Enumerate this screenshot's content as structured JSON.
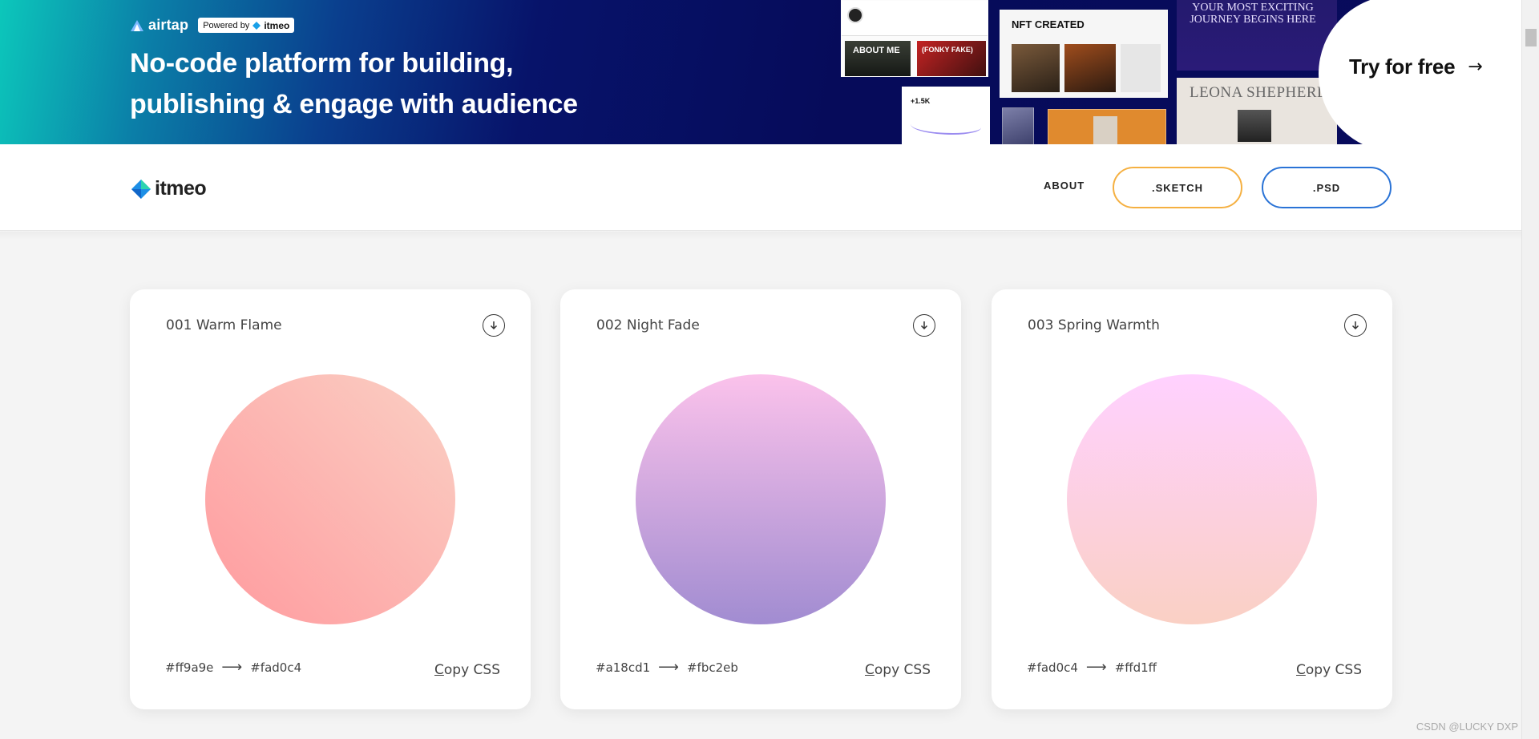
{
  "banner": {
    "brand": "airtap",
    "powered_by": "Powered by",
    "powered_brand": "itmeo",
    "headline_line1": "No-code platform for building,",
    "headline_line2": "publishing & engage with audience",
    "mock_about": "ABOUT ME",
    "mock_fake": "(FONKY FAKE)",
    "mock_nft": "NFT CREATED",
    "mock_stat": "+1.5K",
    "mock_journey": "YOUR MOST EXCITING JOURNEY BEGINS HERE",
    "mock_leona": "LEONA SHEPHERD",
    "cta": "Try for free",
    "cta_arrow": "→"
  },
  "nav": {
    "logo": "itmeo",
    "about": "ABOUT",
    "sketch": ".SKETCH",
    "psd": ".PSD"
  },
  "gradients": [
    {
      "name": "001 Warm Flame",
      "from": "#ff9a9e",
      "to": "#fad0c4",
      "arrow": "⟶",
      "copy": "Copy CSS"
    },
    {
      "name": "002 Night Fade",
      "from": "#a18cd1",
      "to": "#fbc2eb",
      "arrow": "⟶",
      "copy": "Copy CSS"
    },
    {
      "name": "003 Spring Warmth",
      "from": "#fad0c4",
      "to": "#ffd1ff",
      "arrow": "⟶",
      "copy": "Copy CSS"
    }
  ],
  "icons": {
    "download": "download-icon",
    "arrow": "arrow-right-icon",
    "logo": "diamond-logo-icon"
  },
  "watermark": "CSDN @LUCKY DXP"
}
